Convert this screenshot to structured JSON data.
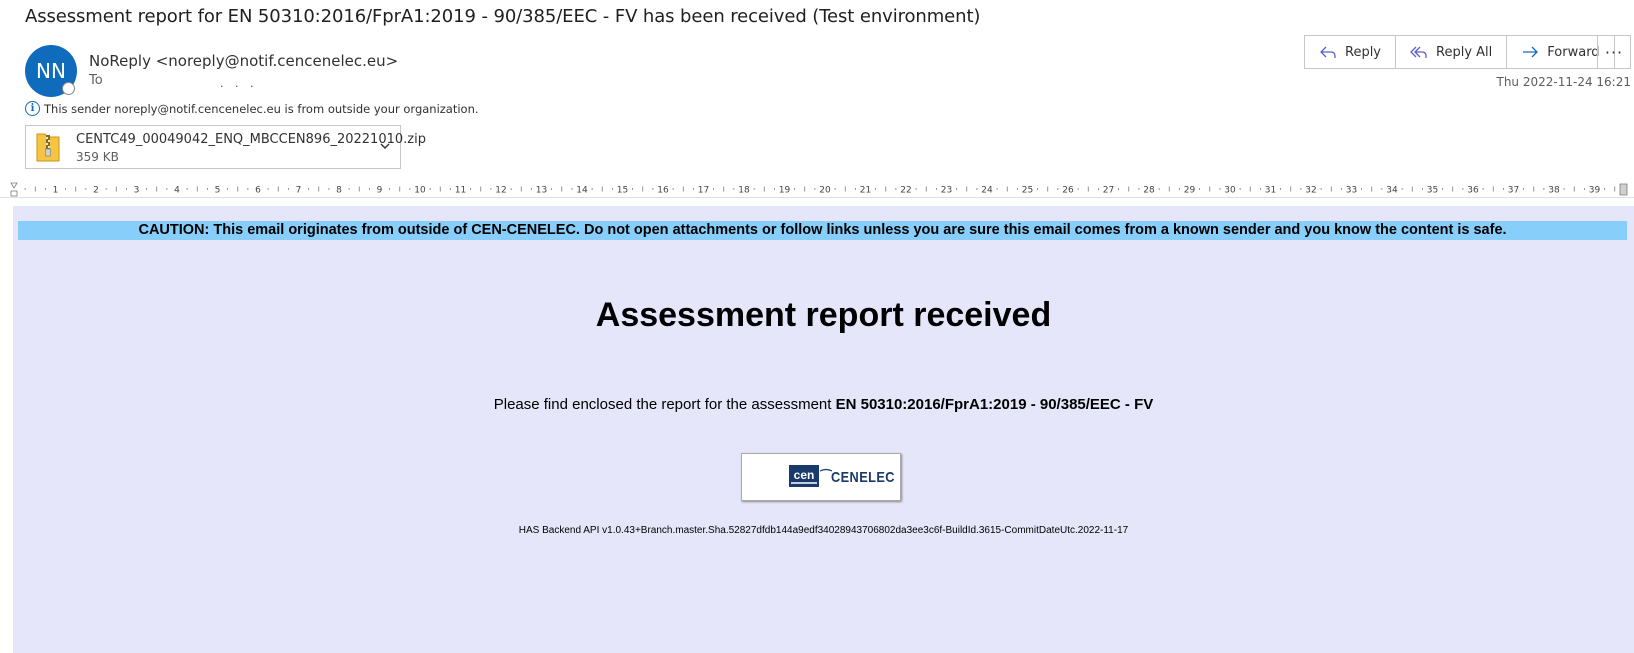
{
  "message": {
    "subject": "Assessment report for EN 50310:2016/FprA1:2019 - 90/385/EEC - FV has been received (Test environment)",
    "sender": {
      "initials": "NN",
      "display": "NoReply <noreply@notif.cencenelec.eu>"
    },
    "to_label": "To",
    "outside_warning": "This sender noreply@notif.cencenelec.eu is from outside your organization.",
    "date": "Thu 2022-11-24 16:21"
  },
  "attachment": {
    "name": "CENTC49_00049042_ENQ_MBCCEN896_20221010.zip",
    "size": "359 KB",
    "icon": "zip-folder-icon"
  },
  "actions": {
    "reply": "Reply",
    "reply_all": "Reply All",
    "forward": "Forward",
    "more": "···"
  },
  "ruler": {
    "marks": [
      "1",
      "2",
      "3",
      "4",
      "5",
      "6",
      "7",
      "8",
      "9",
      "10",
      "11",
      "12",
      "13",
      "14",
      "15",
      "16",
      "17",
      "18",
      "19",
      "20",
      "21",
      "22",
      "23",
      "24",
      "25",
      "26",
      "27",
      "28",
      "29",
      "30",
      "31",
      "32",
      "33",
      "34",
      "35",
      "36",
      "37",
      "38",
      "39"
    ]
  },
  "body": {
    "caution": "CAUTION: This email originates from outside of CEN-CENELEC. Do not open attachments or follow links unless you are sure this email comes from a known sender and you know the content is safe.",
    "headline": "Assessment report received",
    "intro_text": "Please find enclosed the report for the assessment ",
    "intro_bold": "EN 50310:2016/FprA1:2019 - 90/385/EEC - FV",
    "logo_text": "CENELEC",
    "logo_mark_text": "cen",
    "footer": "HAS Backend API v1.0.43+Branch.master.Sha.52827dfdb144a9edf34028943706802da3ee3c6f-BuildId.3615-CommitDateUtc.2022-11-17"
  },
  "colors": {
    "avatar": "#0f6cbd",
    "body_bg": "#e6e6fa",
    "caution_bg": "#87cefa",
    "logo_blue": "#1a3a6b"
  }
}
